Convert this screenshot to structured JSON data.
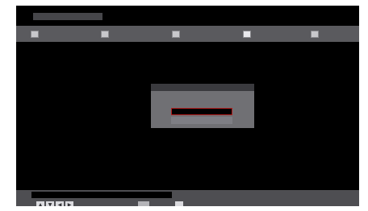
{
  "window": {
    "title": ""
  },
  "tabs": [
    {
      "label": "",
      "icon": "menu-icon",
      "active": false
    },
    {
      "label": "",
      "icon": "menu-icon",
      "active": false
    },
    {
      "label": "",
      "icon": "menu-icon",
      "active": false
    },
    {
      "label": "",
      "icon": "menu-icon",
      "active": true
    },
    {
      "label": "",
      "icon": "menu-icon",
      "active": false
    }
  ],
  "dialog": {
    "title": "",
    "message": "",
    "buttons": [
      {
        "label": "",
        "selected": true
      },
      {
        "label": "",
        "selected": false
      }
    ]
  },
  "footer": {
    "caption": "",
    "navigation": {
      "keys": [
        "up-arrow-icon",
        "down-arrow-icon",
        "left-arrow-icon",
        "right-arrow-icon"
      ],
      "glyphs": [
        "▲",
        "▼",
        "◀",
        "▶"
      ],
      "label": ""
    },
    "confirm": {
      "label": ""
    },
    "back": {
      "label": ""
    }
  },
  "colors": {
    "screen": "#000000",
    "tab_bar": "#5a5a5e",
    "dialog": "#707074",
    "dialog_title": "#3a3a3e",
    "selected_button_border": "#b01e1e",
    "footer_bar": "#4e4e52"
  }
}
